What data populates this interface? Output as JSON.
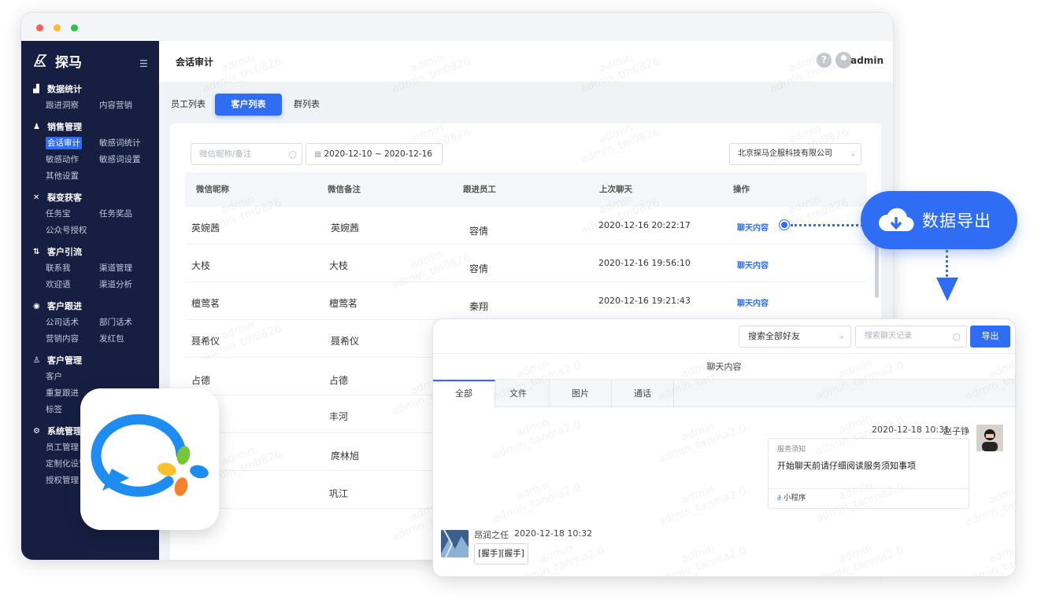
{
  "app": {
    "brand": "探马",
    "page_title": "会话审计",
    "user": "admin",
    "help_glyph": "?"
  },
  "sidebar": {
    "groups": [
      {
        "title": "数据统计",
        "icon": "bar-chart-icon",
        "items": [
          "跟进洞察",
          "内容营销"
        ]
      },
      {
        "title": "销售管理",
        "icon": "person-icon",
        "items": [
          "会话审计",
          "敏感词统计",
          "敏感动作",
          "敏感词设置",
          "其他设置"
        ]
      },
      {
        "title": "裂变获客",
        "icon": "fission-icon",
        "items": [
          "任务宝",
          "任务奖品",
          "公众号授权"
        ]
      },
      {
        "title": "客户引流",
        "icon": "traffic-icon",
        "items": [
          "联系我",
          "渠道管理",
          "欢迎语",
          "渠道分析"
        ]
      },
      {
        "title": "客户跟进",
        "icon": "target-icon",
        "items": [
          "公司话术",
          "部门话术",
          "营销内容",
          "发红包"
        ]
      },
      {
        "title": "客户管理",
        "icon": "customers-icon",
        "items": [
          "客户",
          "重复跟进",
          "标签"
        ]
      },
      {
        "title": "系统管理",
        "icon": "settings-icon",
        "items": [
          "员工管理",
          "定制化设置",
          "授权管理"
        ]
      }
    ],
    "active_item": "会话审计"
  },
  "tabs": [
    "员工列表",
    "客户列表",
    "群列表"
  ],
  "active_tab": "客户列表",
  "filters": {
    "search_placeholder": "微信昵称/备注",
    "date_range": "2020-12-10 ~ 2020-12-16",
    "company": "北京探马企服科技有限公司"
  },
  "table": {
    "headers": [
      "微信昵称",
      "微信备注",
      "跟进员工",
      "上次聊天",
      "操作"
    ],
    "rows": [
      {
        "nick": "英婉茜",
        "remark": "英婉茜",
        "staff": "容倩",
        "last": "2020-12-16 20:22:17",
        "op": "聊天内容"
      },
      {
        "nick": "大枝",
        "remark": "大枝",
        "staff": "容倩",
        "last": "2020-12-16 19:56:10",
        "op": "聊天内容"
      },
      {
        "nick": "檀莺茗",
        "remark": "檀莺茗",
        "staff": "秦翔",
        "last": "2020-12-16 19:21:43",
        "op": "聊天内容"
      },
      {
        "nick": "聂希仪",
        "remark": "聂希仪",
        "staff": "",
        "last": "",
        "op": ""
      },
      {
        "nick": "占德",
        "remark": "占德",
        "staff": "",
        "last": "",
        "op": ""
      },
      {
        "nick": "",
        "remark": "丰河",
        "staff": "",
        "last": "",
        "op": ""
      },
      {
        "nick": "",
        "remark": "庹林旭",
        "staff": "",
        "last": "",
        "op": ""
      },
      {
        "nick": "",
        "remark": "巩江",
        "staff": "",
        "last": "",
        "op": ""
      }
    ]
  },
  "export_callout": {
    "label": "数据导出",
    "icon": "cloud-download-icon"
  },
  "chat": {
    "select_value": "搜索全部好友",
    "search_placeholder": "搜索聊天记录",
    "export_button": "导出",
    "title": "聊天内容",
    "tabs": [
      "全部",
      "文件",
      "图片",
      "通话"
    ],
    "active_tab": "全部",
    "messages": [
      {
        "side": "right",
        "time": "2020-12-18 10:31",
        "sender": "赵子铮",
        "service_label": "服务须知",
        "text": "开始聊天前请仔细阅读服务须知事项",
        "mini_program": "小程序"
      },
      {
        "side": "left",
        "sender": "昂润之任",
        "time": "2020-12-18 10:32",
        "text": "[握手][握手]"
      }
    ]
  },
  "watermarks": {
    "main": "admin\nadmin_tm0826",
    "chat": "admin\nadmin_tanma2.0"
  },
  "colors": {
    "primary": "#2f6df4",
    "sidebar": "#161f42"
  }
}
